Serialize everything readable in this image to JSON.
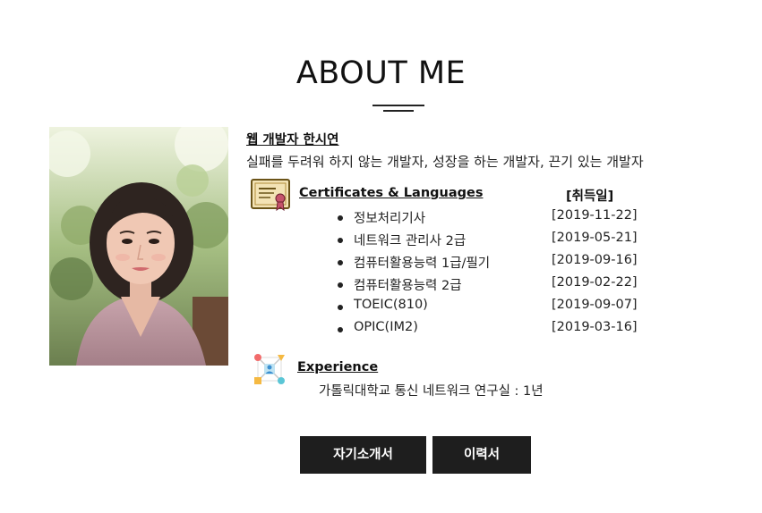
{
  "header": {
    "title": "ABOUT ME"
  },
  "intro": {
    "name": "웹 개발자 한시연",
    "description": "실패를 두려워 하지 않는 개발자, 성장을 하는 개발자, 끈기 있는 개발자"
  },
  "certificates": {
    "heading": "Certificates & Languages",
    "date_heading": "[취득일]",
    "icon": "certificate-icon",
    "items": [
      {
        "name": "정보처리기사",
        "date": "[2019-11-22]"
      },
      {
        "name": "네트워크 관리사 2급",
        "date": "[2019-05-21]"
      },
      {
        "name": "컴퓨터활용능력 1급/필기",
        "date": "[2019-09-16]"
      },
      {
        "name": "컴퓨터활용능력 2급",
        "date": "[2019-02-22]"
      },
      {
        "name": "TOEIC(810)",
        "date": "[2019-09-07]"
      },
      {
        "name": "OPIC(IM2)",
        "date": "[2019-03-16]"
      }
    ]
  },
  "experience": {
    "heading": "Experience",
    "icon": "network-icon",
    "item": "가톨릭대학교 통신 네트워크 연구실 : 1년"
  },
  "buttons": {
    "intro_label": "자기소개서",
    "resume_label": "이력서"
  },
  "colors": {
    "button_bg": "#1e1e1e",
    "button_text": "#ffffff",
    "text": "#222222"
  }
}
